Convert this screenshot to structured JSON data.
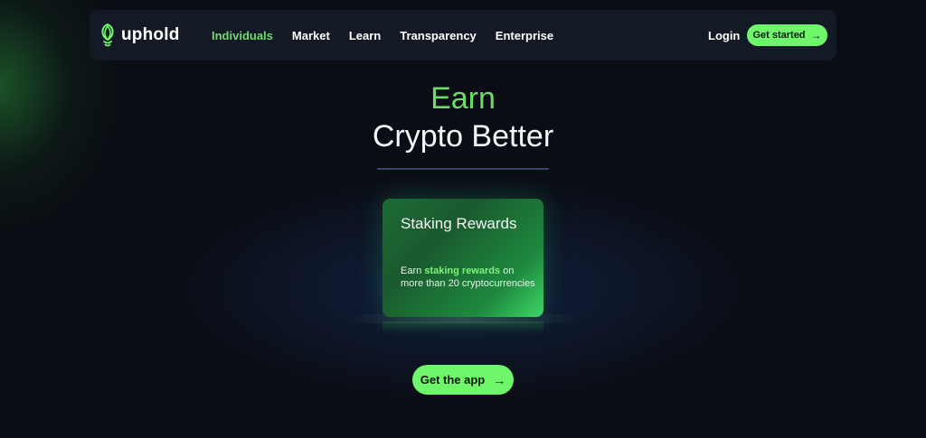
{
  "brand": {
    "name": "uphold",
    "logo_icon": "uphold-logo-icon",
    "accent_color": "#6ef76b"
  },
  "nav": {
    "items": [
      {
        "label": "Individuals",
        "active": true
      },
      {
        "label": "Market",
        "active": false
      },
      {
        "label": "Learn",
        "active": false
      },
      {
        "label": "Transparency",
        "active": false
      },
      {
        "label": "Enterprise",
        "active": false
      }
    ],
    "login_label": "Login",
    "get_started_label": "Get started",
    "get_started_icon": "arrow-right-icon"
  },
  "hero": {
    "line1": "Earn",
    "line2": "Crypto Better"
  },
  "card": {
    "title": "Staking Rewards",
    "desc_prefix": "Earn ",
    "desc_highlight": "staking rewards",
    "desc_suffix": " on more than 20 cryptocurrencies"
  },
  "cta": {
    "label": "Get the app",
    "icon": "arrow-right-icon"
  }
}
